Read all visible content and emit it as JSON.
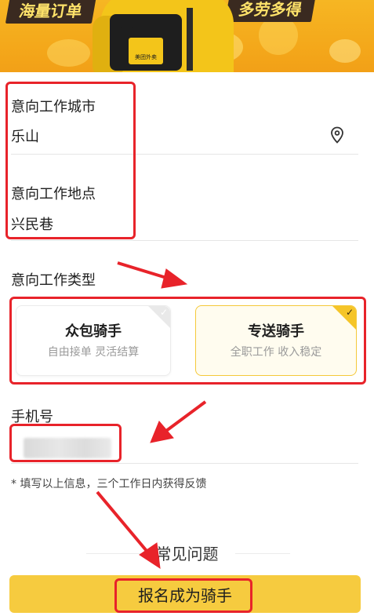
{
  "banner": {
    "left_text": "海量订单",
    "right_text": "多劳多得",
    "box_brand": "美团外卖"
  },
  "form": {
    "city": {
      "label": "意向工作城市",
      "value": "乐山",
      "icon": "location-pin-icon"
    },
    "place": {
      "label": "意向工作地点",
      "value": "兴民巷"
    },
    "work_type": {
      "label": "意向工作类型",
      "options": [
        {
          "title": "众包骑手",
          "subtitle": "自由接单 灵活结算",
          "selected": false
        },
        {
          "title": "专送骑手",
          "subtitle": "全职工作 收入稳定",
          "selected": true
        }
      ],
      "check_glyph": "✓"
    },
    "phone": {
      "label": "手机号"
    },
    "note": "* 填写以上信息，三个工作日内获得反馈"
  },
  "faq": {
    "title": "常见问题"
  },
  "submit": {
    "label": "报名成为骑手"
  },
  "colors": {
    "accent": "#f6cb3f",
    "annotation_red": "#e8232a",
    "banner": "#f4a91b"
  }
}
